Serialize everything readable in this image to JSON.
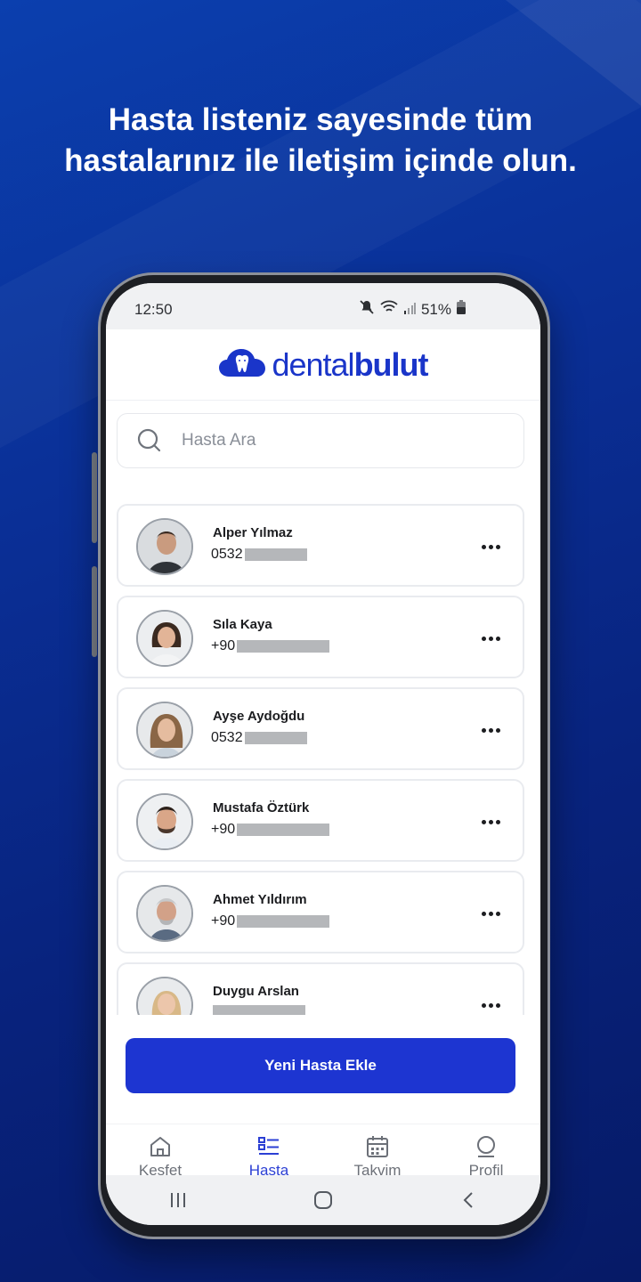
{
  "headline": {
    "line1": "Hasta listeniz sayesinde tüm",
    "line2": "hastalarınız ile iletişim içinde olun."
  },
  "status_bar": {
    "time": "12:50",
    "battery": "51%"
  },
  "app": {
    "logo_light": "dental",
    "logo_bold": "bulut",
    "brand_color": "#1a35c9"
  },
  "search": {
    "placeholder": "Hasta Ara"
  },
  "patients": [
    {
      "name": "Alper Yılmaz",
      "phone_prefix": "0532"
    },
    {
      "name": "Sıla Kaya",
      "phone_prefix": "+90"
    },
    {
      "name": "Ayşe Aydoğdu",
      "phone_prefix": "0532"
    },
    {
      "name": "Mustafa Öztürk",
      "phone_prefix": "+90"
    },
    {
      "name": "Ahmet Yıldırım",
      "phone_prefix": "+90"
    },
    {
      "name": "Duygu Arslan",
      "phone_prefix": ""
    }
  ],
  "add_button": {
    "label": "Yeni Hasta Ekle",
    "color": "#1d35d1"
  },
  "tabs": [
    {
      "label": "Kesfet",
      "icon": "home-icon",
      "active": false
    },
    {
      "label": "Hasta",
      "icon": "list-icon",
      "active": true
    },
    {
      "label": "Takvim",
      "icon": "calendar-icon",
      "active": false
    },
    {
      "label": "Profil",
      "icon": "profile-icon",
      "active": false
    }
  ]
}
